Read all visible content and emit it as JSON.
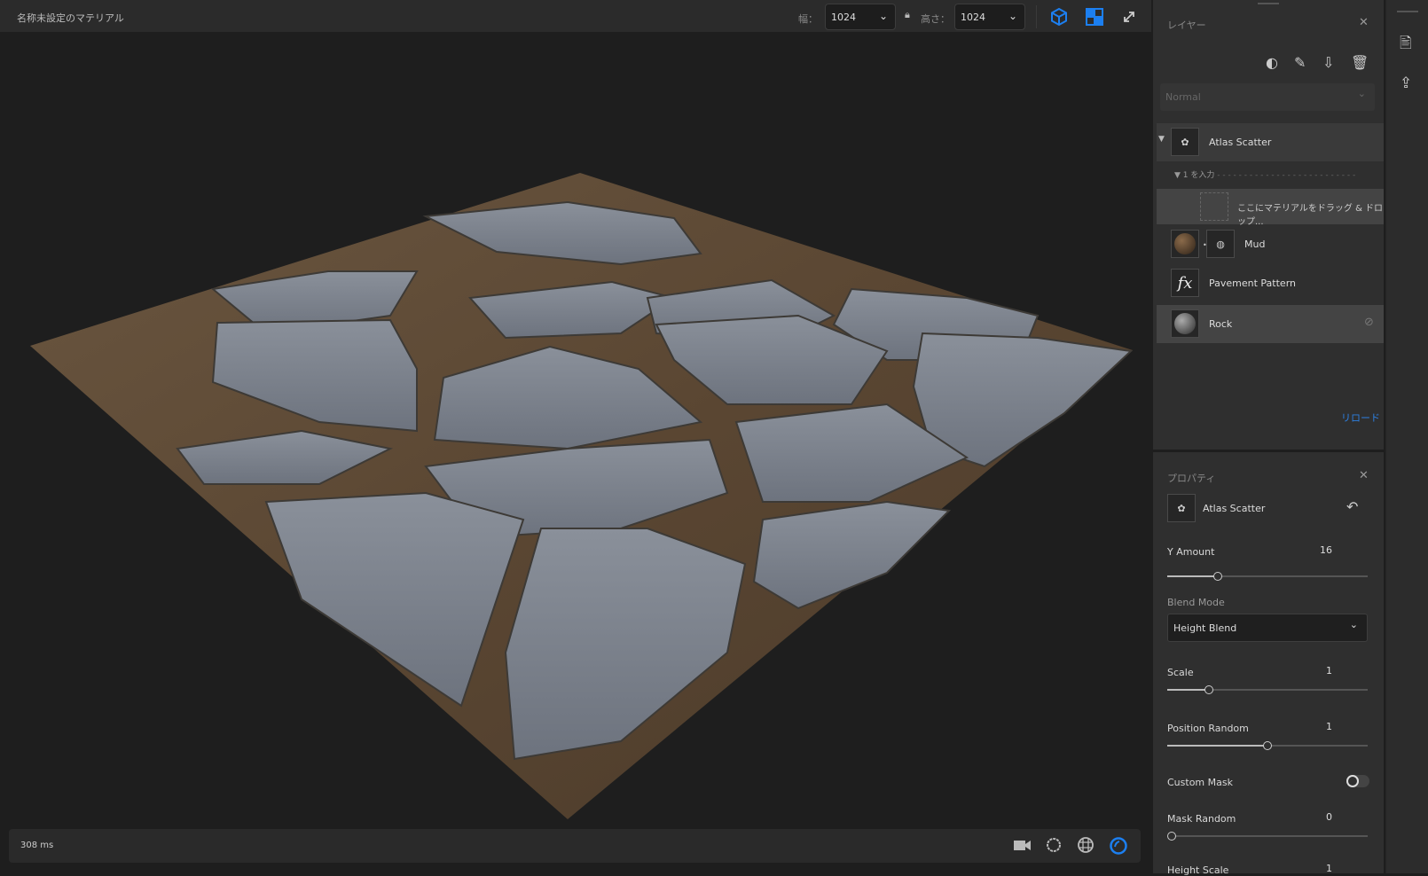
{
  "document": {
    "title": "名称未設定のマテリアル"
  },
  "toolbar": {
    "width_label": "幅：",
    "width_value": "1024",
    "height_label": "高さ：",
    "height_value": "1024",
    "icons": [
      "cube-icon",
      "checker-2d-icon",
      "expand-icon",
      "lock-icon"
    ],
    "accent": "#1473e6"
  },
  "viewport": {
    "render_time": "308 ms",
    "icons": [
      "camera-icon",
      "environment-icon",
      "globe-grid-icon",
      "material-sphere-icon"
    ]
  },
  "layers": {
    "title": "レイヤー",
    "blend_placeholder": "Normal",
    "input_label": "▼ 1 を入力",
    "drop_hint": "ここにマテリアルをドラッグ & ドロップ...",
    "items": [
      {
        "name": "Atlas Scatter",
        "icon": "scatter-icon"
      },
      {
        "name": "Mud",
        "icon": "mud-sphere-icon"
      },
      {
        "name": "Pavement Pattern",
        "icon": "fx-icon"
      },
      {
        "name": "Rock",
        "icon": "rock-sphere-icon",
        "hidden": true
      }
    ],
    "reload": "リロード",
    "actions": [
      "mask-icon",
      "paint-icon",
      "export-icon",
      "trash-icon"
    ]
  },
  "properties": {
    "title": "プロパティ",
    "layer_name": "Atlas Scatter",
    "y_amount": {
      "label": "Y Amount",
      "value": "16",
      "fraction": 0.25
    },
    "blend_mode": {
      "label": "Blend Mode",
      "value": "Height Blend"
    },
    "scale": {
      "label": "Scale",
      "value": "1",
      "fraction": 0.21
    },
    "position_random": {
      "label": "Position Random",
      "value": "1",
      "fraction": 0.5
    },
    "custom_mask": {
      "label": "Custom Mask",
      "on": false
    },
    "mask_random": {
      "label": "Mask Random",
      "value": "0",
      "fraction": 0
    },
    "height_scale": {
      "label": "Height Scale",
      "value": "1"
    }
  }
}
